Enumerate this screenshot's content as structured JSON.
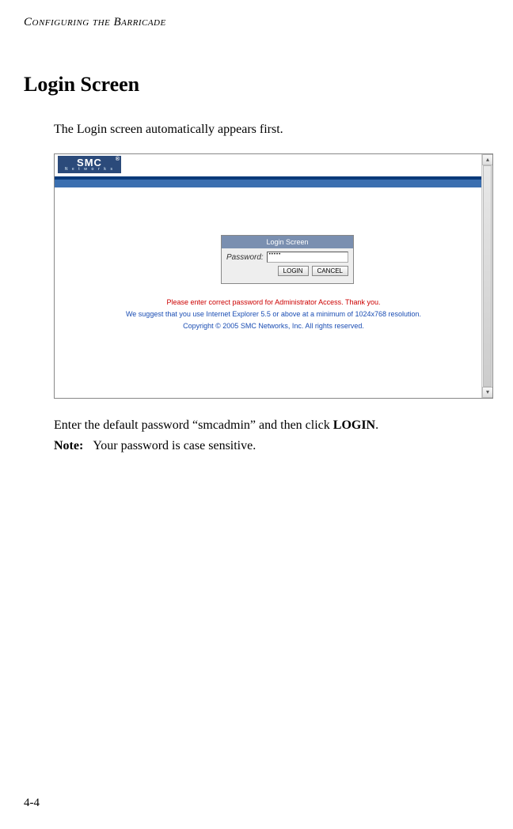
{
  "header": {
    "running_head": "Configuring the Barricade"
  },
  "section": {
    "title": "Login Screen"
  },
  "para1": "The Login screen automatically appears first.",
  "screenshot": {
    "logo": {
      "main": "SMC",
      "reg": "®",
      "sub": "N e t w o r k s"
    },
    "login": {
      "title": "Login Screen",
      "password_label": "Password:",
      "password_value": "•••••",
      "login_btn": "LOGIN",
      "cancel_btn": "CANCEL"
    },
    "msg_red": "Please enter correct password for Administrator Access. Thank you.",
    "msg_blue1": "We suggest that you use Internet Explorer 5.5 or above at a minimum of 1024x768 resolution.",
    "msg_blue2": "Copyright © 2005 SMC Networks, Inc. All rights reserved."
  },
  "para2_pre": "Enter the default password “smcadmin” and then click ",
  "para2_bold": "LOGIN",
  "para2_post": ".",
  "note": {
    "label": "Note:",
    "text": "Your password is case sensitive."
  },
  "page_number": "4-4"
}
